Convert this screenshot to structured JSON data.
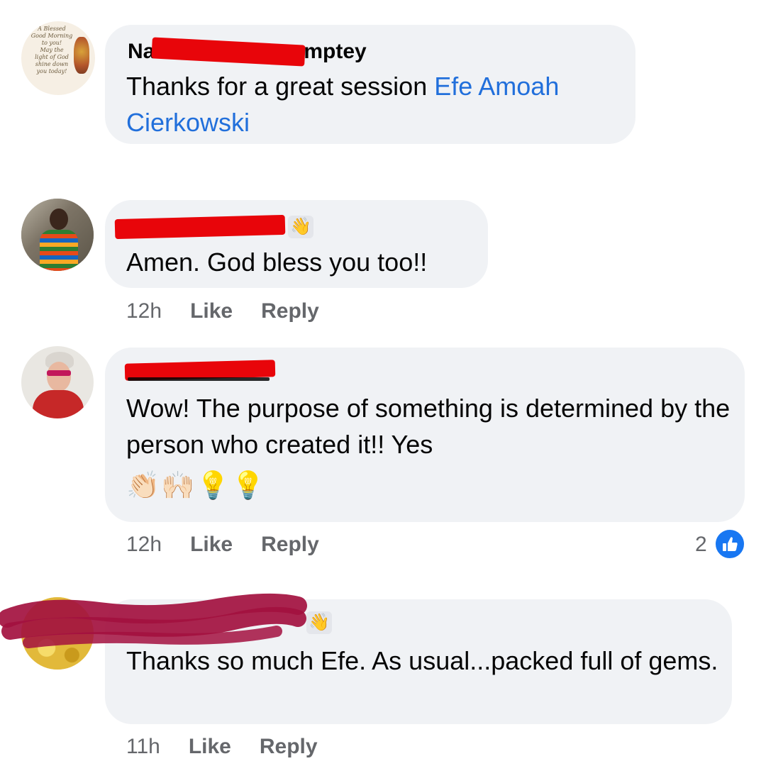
{
  "comments": [
    {
      "author_visible": "Na…mptey",
      "author_prefix": "Na",
      "author_suffix": "mptey",
      "text_before_mention": "Thanks for a great session ",
      "mention": "Efe Amoah Cierkowski",
      "avatar_lines": [
        "A Blessed",
        "Good Morning",
        "to you!",
        "May the",
        "light of God",
        "shine down",
        "you today!"
      ]
    },
    {
      "text": "Amen. God bless you too!!",
      "time": "12h",
      "like": "Like",
      "reply": "Reply",
      "badge_icon": "waving-hand-icon"
    },
    {
      "text": "Wow! The purpose of something is determined by the person who created it!! Yes",
      "emoji": "👏🏻🙌🏻💡💡",
      "time": "12h",
      "like": "Like",
      "reply": "Reply",
      "reaction_count": "2",
      "reaction_icon": "thumbs-up-icon"
    },
    {
      "text": "Thanks so much Efe. As usual...packed full of gems.",
      "time": "11h",
      "like": "Like",
      "reply": "Reply",
      "badge_icon": "waving-hand-icon"
    }
  ],
  "colors": {
    "bubble": "#f0f2f5",
    "mention": "#216fdb",
    "meta": "#65676b",
    "redaction_red": "#e8050a",
    "redaction_crimson": "#a3113f",
    "like_blue": "#1877f2"
  }
}
